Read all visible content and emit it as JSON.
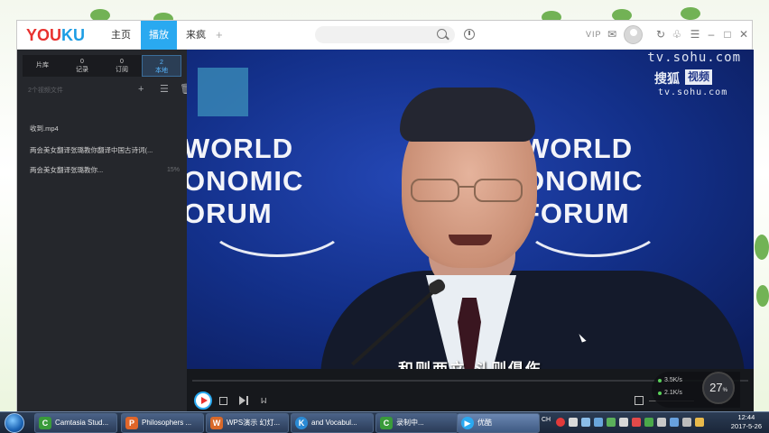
{
  "app": {
    "logo_part1": "YOU",
    "logo_part2": "KU",
    "tabs": [
      {
        "label": "主页"
      },
      {
        "label": "播放"
      },
      {
        "label": "来疯"
      }
    ],
    "add_tab": "+",
    "search_placeholder": "",
    "vip_label": "VIP"
  },
  "sidebar": {
    "tabs": [
      {
        "count": "",
        "label": "片库"
      },
      {
        "count": "0",
        "label": "记录"
      },
      {
        "count": "0",
        "label": "订阅"
      },
      {
        "count": "2",
        "label": "本地"
      }
    ],
    "section_label": "2个视频文件",
    "files": [
      {
        "name": "收到.mp4",
        "progress": ""
      },
      {
        "name": "两会美女翻译张璐教你翻译中国古诗词(...",
        "progress": ""
      },
      {
        "name": "两会美女翻译张璐教你...",
        "progress": "15%"
      }
    ]
  },
  "video": {
    "watermark_url_top": "tv.sohu.com",
    "watermark_brand": "搜狐",
    "watermark_brand_box": "视频",
    "watermark_url": "tv.sohu.com",
    "banner_lines": [
      "WORLD",
      "ONOMIC",
      "FORUM"
    ],
    "banner_lines_left": [
      "WORLD",
      "ONOMIC",
      "ORUM"
    ],
    "subtitle": "和则两立 斗则俱伤",
    "progress_fraction": 0.0
  },
  "speed": {
    "down": "3.5K/s",
    "up": "2.1K/s",
    "value": "27",
    "unit": "%"
  },
  "taskbar": {
    "items": [
      {
        "label": "Camtasia Stud...",
        "icon": "C",
        "color": "#3a9b3a"
      },
      {
        "label": "Philosophers ...",
        "icon": "P",
        "color": "#e0662a"
      },
      {
        "label": "WPS演示 幻灯...",
        "icon": "W",
        "color": "#d8692a"
      },
      {
        "label": "and Vocabul...",
        "icon": "K",
        "color": "#2b8ad4"
      },
      {
        "label": "录制中...",
        "icon": "C",
        "color": "#3a9b3a"
      },
      {
        "label": "优酷",
        "icon": "▶",
        "color": "#2aa9f0"
      }
    ],
    "tray_label": "CH",
    "time": "12:44",
    "date": "2017-5-26"
  }
}
